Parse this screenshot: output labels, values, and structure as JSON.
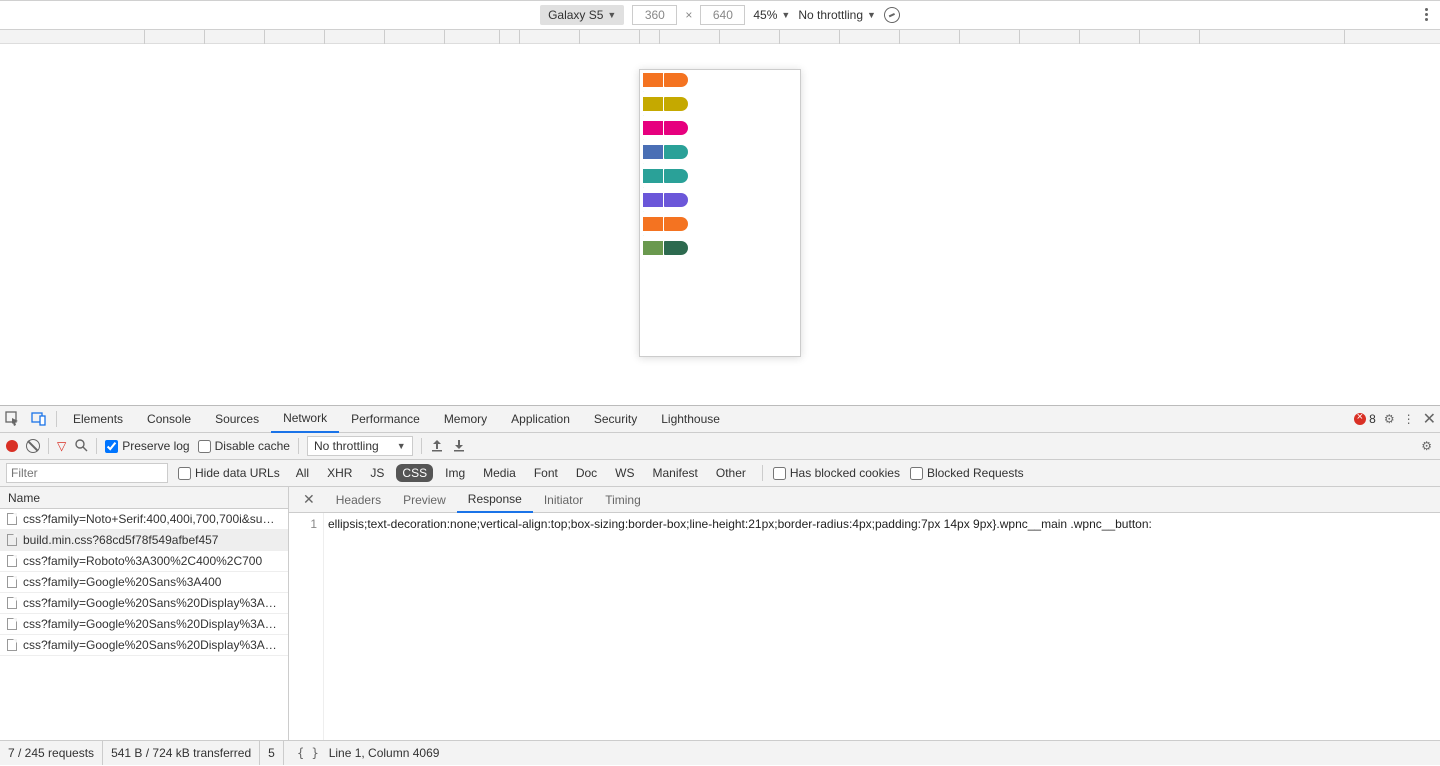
{
  "device_toolbar": {
    "device": "Galaxy S5",
    "width": "360",
    "height": "640",
    "zoom": "45%",
    "throttling": "No throttling"
  },
  "viewport_cards": [
    {
      "thumb": "#f47321",
      "badge": "#f47321"
    },
    {
      "thumb": "#c5a900",
      "badge": "#c5a900"
    },
    {
      "thumb": "#e6007e",
      "badge": "#e6007e"
    },
    {
      "thumb": "#4a6fb5",
      "badge": "#2aa198"
    },
    {
      "thumb": "#2aa198",
      "badge": "#2aa198"
    },
    {
      "thumb": "#6b57d9",
      "badge": "#6b57d9"
    },
    {
      "thumb": "#f47321",
      "badge": "#f47321"
    },
    {
      "thumb": "#6a994e",
      "badge": "#2d6a4f"
    }
  ],
  "main_tabs": {
    "items": [
      "Elements",
      "Console",
      "Sources",
      "Network",
      "Performance",
      "Memory",
      "Application",
      "Security",
      "Lighthouse"
    ],
    "active": "Network",
    "error_count": "8"
  },
  "net_toolbar": {
    "preserve_log": "Preserve log",
    "preserve_log_checked": true,
    "disable_cache": "Disable cache",
    "disable_cache_checked": false,
    "throttling": "No throttling"
  },
  "filter_bar": {
    "placeholder": "Filter",
    "hide_data_urls": "Hide data URLs",
    "chips": [
      "All",
      "XHR",
      "JS",
      "CSS",
      "Img",
      "Media",
      "Font",
      "Doc",
      "WS",
      "Manifest",
      "Other"
    ],
    "active_chip": "CSS",
    "has_blocked_cookies": "Has blocked cookies",
    "blocked_requests": "Blocked Requests"
  },
  "req_list": {
    "header": "Name",
    "rows": [
      "css?family=Noto+Serif:400,400i,700,700i&su…",
      "build.min.css?68cd5f78f549afbef457",
      "css?family=Roboto%3A300%2C400%2C700",
      "css?family=Google%20Sans%3A400",
      "css?family=Google%20Sans%20Display%3A…",
      "css?family=Google%20Sans%20Display%3A…",
      "css?family=Google%20Sans%20Display%3A…"
    ],
    "selected": 1
  },
  "detail_tabs": {
    "items": [
      "Headers",
      "Preview",
      "Response",
      "Initiator",
      "Timing"
    ],
    "active": "Response"
  },
  "code": {
    "line_no": "1",
    "text": "ellipsis;text-decoration:none;vertical-align:top;box-sizing:border-box;line-height:21px;border-radius:4px;padding:7px 14px 9px}.wpnc__main .wpnc__button:"
  },
  "status": {
    "requests": "7 / 245 requests",
    "transferred": "541 B / 724 kB transferred",
    "resources_trunc": "5",
    "cursor": "Line 1, Column 4069"
  }
}
